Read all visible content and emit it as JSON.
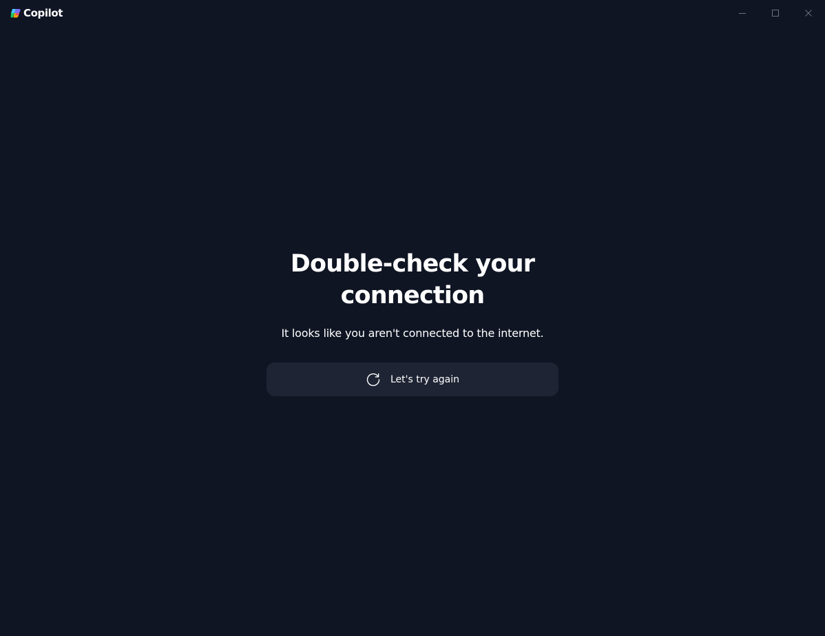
{
  "app": {
    "name": "Copilot",
    "logo_icon": "copilot-logo-icon"
  },
  "window_controls": {
    "minimize_icon": "minimize-icon",
    "maximize_icon": "maximize-icon",
    "close_icon": "close-icon"
  },
  "error": {
    "title": "Double-check your connection",
    "message": "It looks like you aren't connected to the internet.",
    "retry_label": "Let's try again",
    "retry_icon": "refresh-icon"
  },
  "colors": {
    "background": "#0f1523",
    "button_background": "#1e2433",
    "text": "#ffffff",
    "window_control": "#6b7280"
  }
}
